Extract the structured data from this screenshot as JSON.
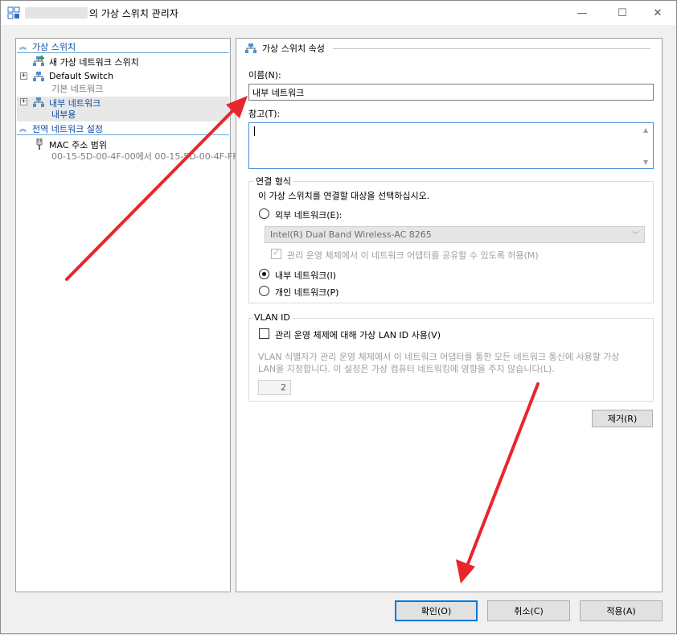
{
  "window": {
    "title": "의 가상 스위치 관리자",
    "minimize": "—",
    "maximize": "☐",
    "close": "✕"
  },
  "tree": {
    "section_switches": "가상 스위치",
    "new_switch": "새 가상 네트워크 스위치",
    "default_switch": {
      "label": "Default Switch",
      "sub": "기본 네트워크"
    },
    "internal_switch": {
      "label": "내부 네트워크",
      "sub": "내부용"
    },
    "section_global": "전역 네트워크 설정",
    "mac_range": {
      "label": "MAC 주소 범위",
      "sub": "00-15-5D-00-4F-00에서 00-15-5D-00-4F-FF"
    }
  },
  "properties": {
    "title": "가상 스위치 속성",
    "name_label": "이름(N):",
    "name_value": "내부 네트워크",
    "notes_label": "참고(T):",
    "notes_value": "",
    "connection": {
      "group_label": "연결 형식",
      "instruction": "이 가상 스위치를 연결할 대상을 선택하십시오.",
      "external_label": "외부 네트워크(E):",
      "adapter": "Intel(R) Dual Band Wireless-AC 8265",
      "share_label": "관리 운영 체제에서 이 네트워크 어댑터를 공유할 수 있도록 허용(M)",
      "share_checked": true,
      "internal_label": "내부 네트워크(I)",
      "private_label": "개인 네트워크(P)",
      "selected": "internal"
    },
    "vlan": {
      "group_label": "VLAN ID",
      "enable_label": "관리 운영 체제에 대해 가상 LAN ID 사용(V)",
      "enabled": false,
      "description_line1": "VLAN 식별자가 관리 운영 체제에서 이 네트워크 어댑터를 통한 모든 네트워크 통신에 사용할 가상",
      "description_line2": "LAN을 지정합니다. 이 설정은 가상 컴퓨터 네트워킹에 영향을 주지 않습니다(L).",
      "id_value": "2"
    },
    "remove_label": "제거(R)"
  },
  "footer": {
    "ok_label": "확인(O)",
    "cancel_label": "취소(C)",
    "apply_label": "적용(A)"
  },
  "colors": {
    "accent": "#0078d7",
    "tree_header": "#0b4aa2",
    "annotation_arrow": "#e8262b"
  }
}
